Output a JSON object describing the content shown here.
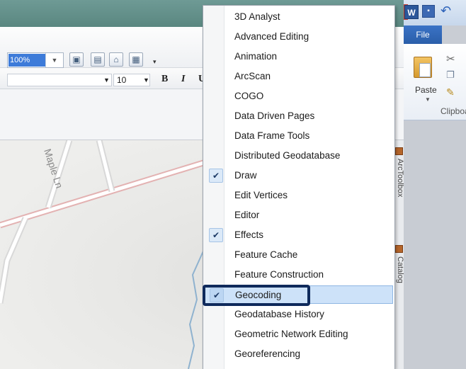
{
  "toolbar": {
    "zoom_value": "100%",
    "font_size": "10",
    "bold_label": "B",
    "italic_label": "I",
    "underline_label": "U"
  },
  "map": {
    "street_label": "Maple Ln"
  },
  "dock": {
    "tab1": "ArcToolbox",
    "tab2": "Catalog"
  },
  "word": {
    "file_tab": "File",
    "paste_label": "Paste",
    "clipboard_label": "Clipboard"
  },
  "menu": {
    "items": [
      {
        "label": "3D Analyst",
        "checked": false
      },
      {
        "label": "Advanced Editing",
        "checked": false
      },
      {
        "label": "Animation",
        "checked": false
      },
      {
        "label": "ArcScan",
        "checked": false
      },
      {
        "label": "COGO",
        "checked": false
      },
      {
        "label": "Data Driven Pages",
        "checked": false
      },
      {
        "label": "Data Frame Tools",
        "checked": false
      },
      {
        "label": "Distributed Geodatabase",
        "checked": false
      },
      {
        "label": "Draw",
        "checked": true
      },
      {
        "label": "Edit Vertices",
        "checked": false
      },
      {
        "label": "Editor",
        "checked": false
      },
      {
        "label": "Effects",
        "checked": true
      },
      {
        "label": "Feature Cache",
        "checked": false
      },
      {
        "label": "Feature Construction",
        "checked": false
      },
      {
        "label": "Geocoding",
        "checked": true,
        "highlighted": true
      },
      {
        "label": "Geodatabase History",
        "checked": false
      },
      {
        "label": "Geometric Network Editing",
        "checked": false
      },
      {
        "label": "Georeferencing",
        "checked": false
      }
    ]
  },
  "colors": {
    "highlight": "#cde2f9",
    "focus_outline": "#0f2a5c",
    "word_blue": "#2b579a"
  }
}
